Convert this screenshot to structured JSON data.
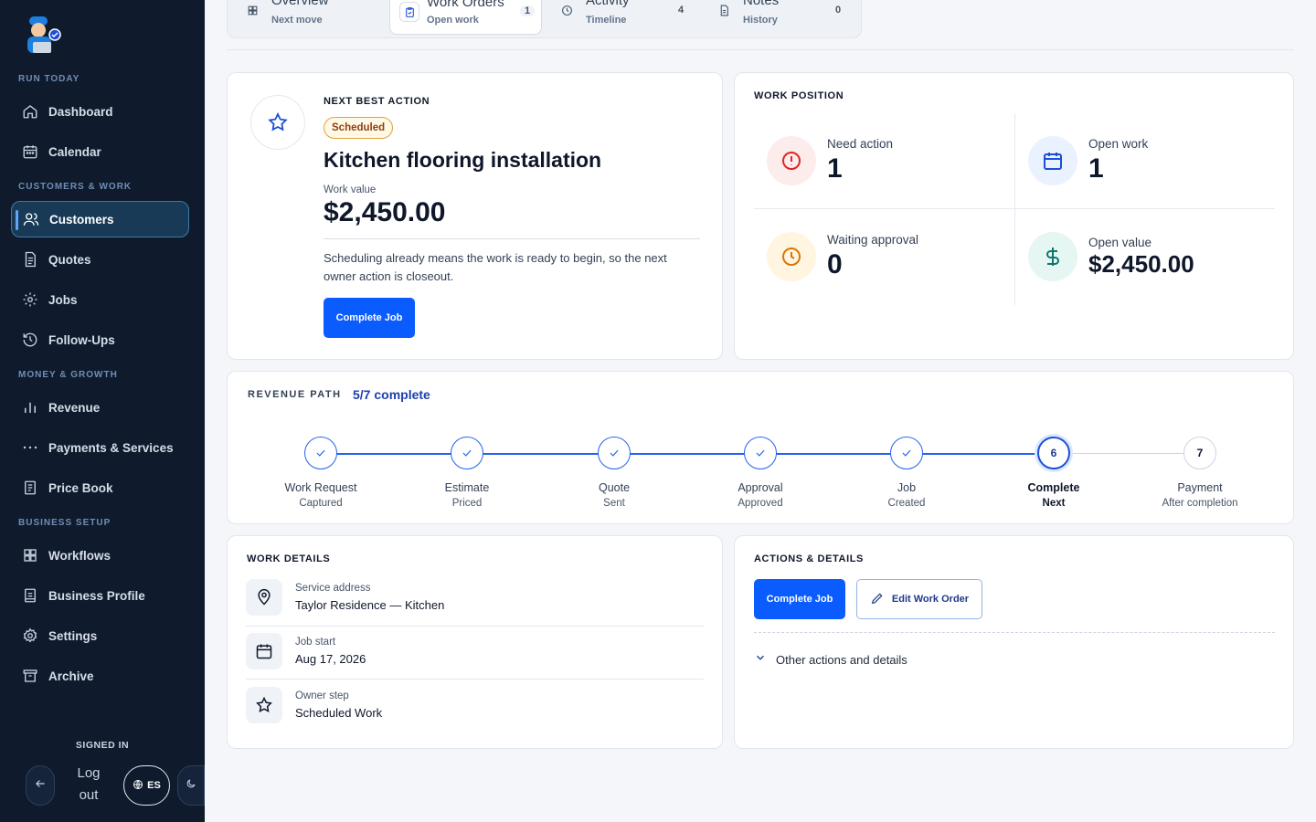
{
  "sidebar": {
    "sections": {
      "run_today": "RUN TODAY",
      "customers_work": "CUSTOMERS & WORK",
      "money_growth": "MONEY & GROWTH",
      "business_setup": "BUSINESS SETUP"
    },
    "items": [
      {
        "label": "Dashboard",
        "icon": "home-icon"
      },
      {
        "label": "Calendar",
        "icon": "calendar-icon"
      },
      {
        "label": "Customers",
        "icon": "users-icon",
        "active": true
      },
      {
        "label": "Quotes",
        "icon": "document-icon"
      },
      {
        "label": "Jobs",
        "icon": "gear-icon"
      },
      {
        "label": "Follow-Ups",
        "icon": "history-icon"
      },
      {
        "label": "Revenue",
        "icon": "bar-chart-icon"
      },
      {
        "label": "Payments & Services",
        "icon": "more-dots-icon"
      },
      {
        "label": "Price Book",
        "icon": "book-icon"
      },
      {
        "label": "Workflows",
        "icon": "grid-icon"
      },
      {
        "label": "Business Profile",
        "icon": "profile-icon"
      },
      {
        "label": "Settings",
        "icon": "settings-icon"
      },
      {
        "label": "Archive",
        "icon": "archive-icon"
      }
    ],
    "signed_in": "SIGNED IN",
    "logout": "Log out",
    "lang": "ES"
  },
  "tabs": [
    {
      "title": "Overview",
      "sub": "Next move",
      "count": ""
    },
    {
      "title": "Work Orders",
      "sub": "Open work",
      "count": "1"
    },
    {
      "title": "Activity",
      "sub": "Timeline",
      "count": "4"
    },
    {
      "title": "Notes",
      "sub": "History",
      "count": "0"
    }
  ],
  "next_action": {
    "heading": "NEXT BEST ACTION",
    "badge": "Scheduled",
    "title": "Kitchen flooring installation",
    "value_label": "Work value",
    "value": "$2,450.00",
    "description": "Scheduling already means the work is ready to begin, so the next owner action is closeout.",
    "button": "Complete Job"
  },
  "work_position": {
    "heading": "WORK POSITION",
    "stats": [
      {
        "label": "Need action",
        "value": "1"
      },
      {
        "label": "Open work",
        "value": "1"
      },
      {
        "label": "Waiting approval",
        "value": "0"
      },
      {
        "label": "Open value",
        "value": "$2,450.00"
      }
    ]
  },
  "revenue_path": {
    "heading": "REVENUE PATH",
    "progress": "5/7 complete",
    "steps": [
      {
        "node": "",
        "title": "Work Request",
        "sub": "Captured",
        "done": true
      },
      {
        "node": "",
        "title": "Estimate",
        "sub": "Priced",
        "done": true
      },
      {
        "node": "",
        "title": "Quote",
        "sub": "Sent",
        "done": true
      },
      {
        "node": "",
        "title": "Approval",
        "sub": "Approved",
        "done": true
      },
      {
        "node": "",
        "title": "Job",
        "sub": "Created",
        "done": true
      },
      {
        "node": "6",
        "title": "Complete",
        "sub": "Next",
        "current": true
      },
      {
        "node": "7",
        "title": "Payment",
        "sub": "After completion"
      }
    ]
  },
  "work_details": {
    "heading": "WORK DETAILS",
    "rows": [
      {
        "label": "Service address",
        "value": "Taylor Residence — Kitchen",
        "icon": "map-pin-icon"
      },
      {
        "label": "Job start",
        "value": "Aug 17, 2026",
        "icon": "calendar-icon"
      },
      {
        "label": "Owner step",
        "value": "Scheduled Work",
        "icon": "star-icon"
      }
    ]
  },
  "actions": {
    "heading": "ACTIONS & DETAILS",
    "primary": "Complete Job",
    "secondary": "Edit Work Order",
    "more": "Other actions and details"
  },
  "colors": {
    "sidebar_bg": "#0f1b2d",
    "primary": "#0b5cff",
    "accent_red": "#dc2626",
    "accent_amber": "#d97706",
    "accent_teal": "#0f766e"
  }
}
